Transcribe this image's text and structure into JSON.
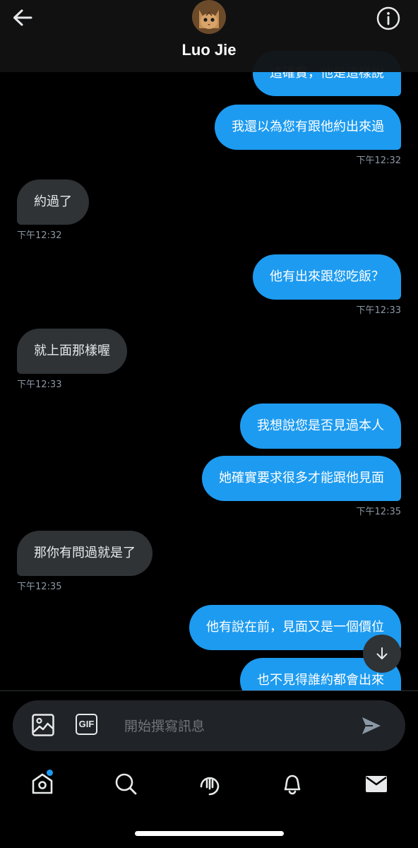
{
  "header": {
    "contact_name": "Luo Jie",
    "icons": {
      "back": "arrow-left-icon",
      "info": "info-circle-icon",
      "avatar": "cat-avatar"
    }
  },
  "messages": [
    {
      "direction": "out",
      "text": "這確實，他是這樣說"
    },
    {
      "direction": "out",
      "text": "我還以為您有跟他約出來過",
      "time": "下午12:32"
    },
    {
      "direction": "in",
      "text": "約過了",
      "time": "下午12:32"
    },
    {
      "direction": "out",
      "text": "他有出來跟您吃飯？",
      "time": "下午12:33"
    },
    {
      "direction": "in",
      "text": "就上面那樣喔",
      "time": "下午12:33"
    },
    {
      "direction": "out",
      "text": "我想說您是否見過本人"
    },
    {
      "direction": "out",
      "text": "她確實要求很多才能跟他見面",
      "time": "下午12:35"
    },
    {
      "direction": "in",
      "text": "那你有問過就是了",
      "time": "下午12:35"
    },
    {
      "direction": "out",
      "text": "他有說在前，見面又是一個價位"
    },
    {
      "direction": "out",
      "text": "也不見得誰約都會出來"
    }
  ],
  "composer": {
    "placeholder": "開始撰寫訊息",
    "gif_label": "GIF",
    "icons": {
      "image": "image-icon",
      "gif": "gif-icon",
      "send": "send-icon"
    }
  },
  "tabs": [
    {
      "name": "home",
      "icon": "home-icon",
      "has_badge": true
    },
    {
      "name": "search",
      "icon": "search-icon"
    },
    {
      "name": "spaces",
      "icon": "spaces-icon"
    },
    {
      "name": "notifications",
      "icon": "bell-icon"
    },
    {
      "name": "messages",
      "icon": "mail-icon",
      "active": true
    }
  ],
  "colors": {
    "accent": "#1d9bf0",
    "incoming_bubble": "#2f3336",
    "background": "#000000"
  }
}
